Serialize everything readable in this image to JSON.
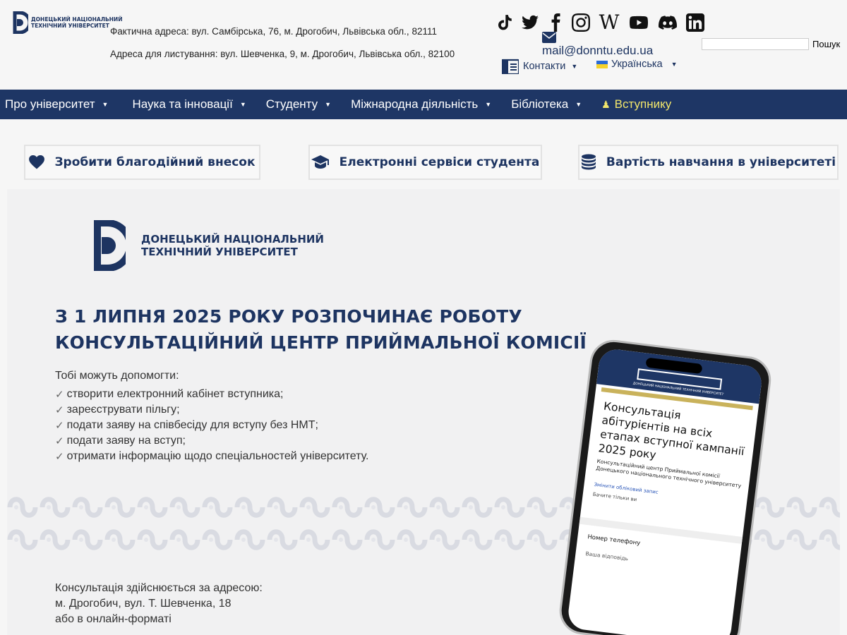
{
  "header": {
    "logo_line1": "ДОНЕЦЬКИЙ НАЦІОНАЛЬНИЙ",
    "logo_line2": "ТЕХНІЧНИЙ УНІВЕРСИТЕТ",
    "address_actual": "Фактична адреса: вул. Самбірська, 76, м. Дрогобич, Львівська обл., 82111",
    "address_postal": "Адреса для листування: вул. Шевченка, 9, м. Дрогобич, Львівська обл., 82100",
    "socials": [
      "tiktok-icon",
      "twitter-icon",
      "facebook-icon",
      "instagram-icon",
      "wikipedia-icon",
      "youtube-icon",
      "discord-icon",
      "linkedin-icon"
    ],
    "wiki_glyph": "W",
    "email": "mail@donntu.edu.ua",
    "contacts_label": "Контакти",
    "language_label": "Українська",
    "search_button": "Пошук",
    "search_value": ""
  },
  "nav": {
    "items": [
      {
        "label": "Про університет",
        "dropdown": true
      },
      {
        "label": "Наука та інновації",
        "dropdown": true
      },
      {
        "label": "Студенту",
        "dropdown": true
      },
      {
        "label": "Міжнародна діяльність",
        "dropdown": true
      },
      {
        "label": "Бібліотека",
        "dropdown": true
      },
      {
        "label": "Вступнику",
        "dropdown": false,
        "highlight_color": "#f2e66b"
      }
    ]
  },
  "quick_links": [
    {
      "label": "Зробити благодійний внесок",
      "icon": "heart-icon"
    },
    {
      "label": "Електронні сервіси студента",
      "icon": "graduation-cap-icon"
    },
    {
      "label": "Вартість навчання в університеті",
      "icon": "coins-icon"
    }
  ],
  "banner": {
    "logo_line1": "ДОНЕЦЬКИЙ НАЦІОНАЛЬНИЙ",
    "logo_line2": "ТЕХНІЧНИЙ УНІВЕРСИТЕТ",
    "headline_line1": "З 1 ЛИПНЯ 2025 РОКУ РОЗПОЧИНАЄ РОБОТУ",
    "headline_line2": "КОНСУЛЬТАЦІЙНИЙ ЦЕНТР ПРИЙМАЛЬНОЇ КОМІСІЇ",
    "intro": "Тобі можуть допомогти:",
    "help_items": [
      "створити електронний кабінет вступника;",
      "зареєструвати пільгу;",
      "подати заяву на співбесіду для вступу без НМТ;",
      "подати заяву на вступ;",
      "отримати інформацію щодо спеціальностей університету."
    ],
    "consult_line1": "Консультація здійснюється за адресою:",
    "consult_line2": "м. Дрогобич, вул. Т. Шевченка, 18",
    "consult_line3": "або в онлайн-форматі",
    "phone": {
      "header_text": "ДОНЕЦЬКИЙ НАЦІОНАЛЬНИЙ ТЕХНІЧНИЙ УНІВЕРСИТЕТ",
      "title": "Консультація абітурієнтів на всіх етапах вступної кампанії 2025 року",
      "subtitle": "Консультаційний центр Приймальної комісії Донецького національного технічного університету",
      "link": "Змінити обліковий запис",
      "see_only": "Бачите тільки ви",
      "field_label": "Номер телефону",
      "answer_placeholder": "Ваша відповідь"
    }
  },
  "colors": {
    "brand_navy": "#1e3665",
    "accent_yellow": "#f2e66b"
  }
}
